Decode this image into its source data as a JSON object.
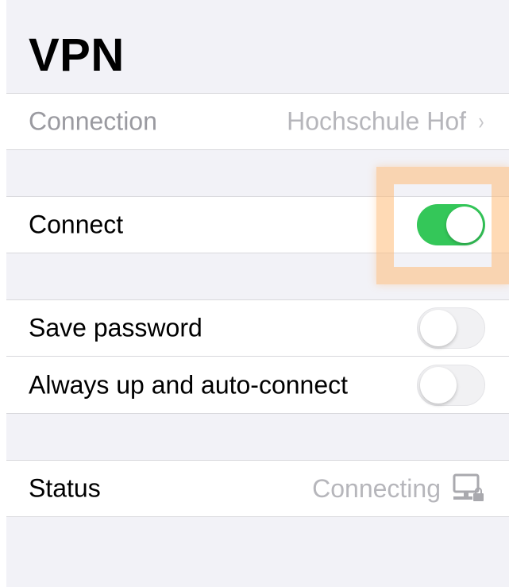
{
  "header": {
    "title": "VPN"
  },
  "connection": {
    "label": "Connection",
    "value": "Hochschule Hof",
    "chevron": "›"
  },
  "connect": {
    "label": "Connect",
    "toggle_on": true
  },
  "save_password": {
    "label": "Save password",
    "toggle_on": false
  },
  "always_up": {
    "label": "Always up and auto-connect",
    "toggle_on": false
  },
  "status": {
    "label": "Status",
    "value": "Connecting",
    "icon": "network-computer-icon"
  },
  "colors": {
    "toggle_on": "#34c759",
    "background": "#f2f2f7",
    "highlight": "#ffbc78"
  }
}
